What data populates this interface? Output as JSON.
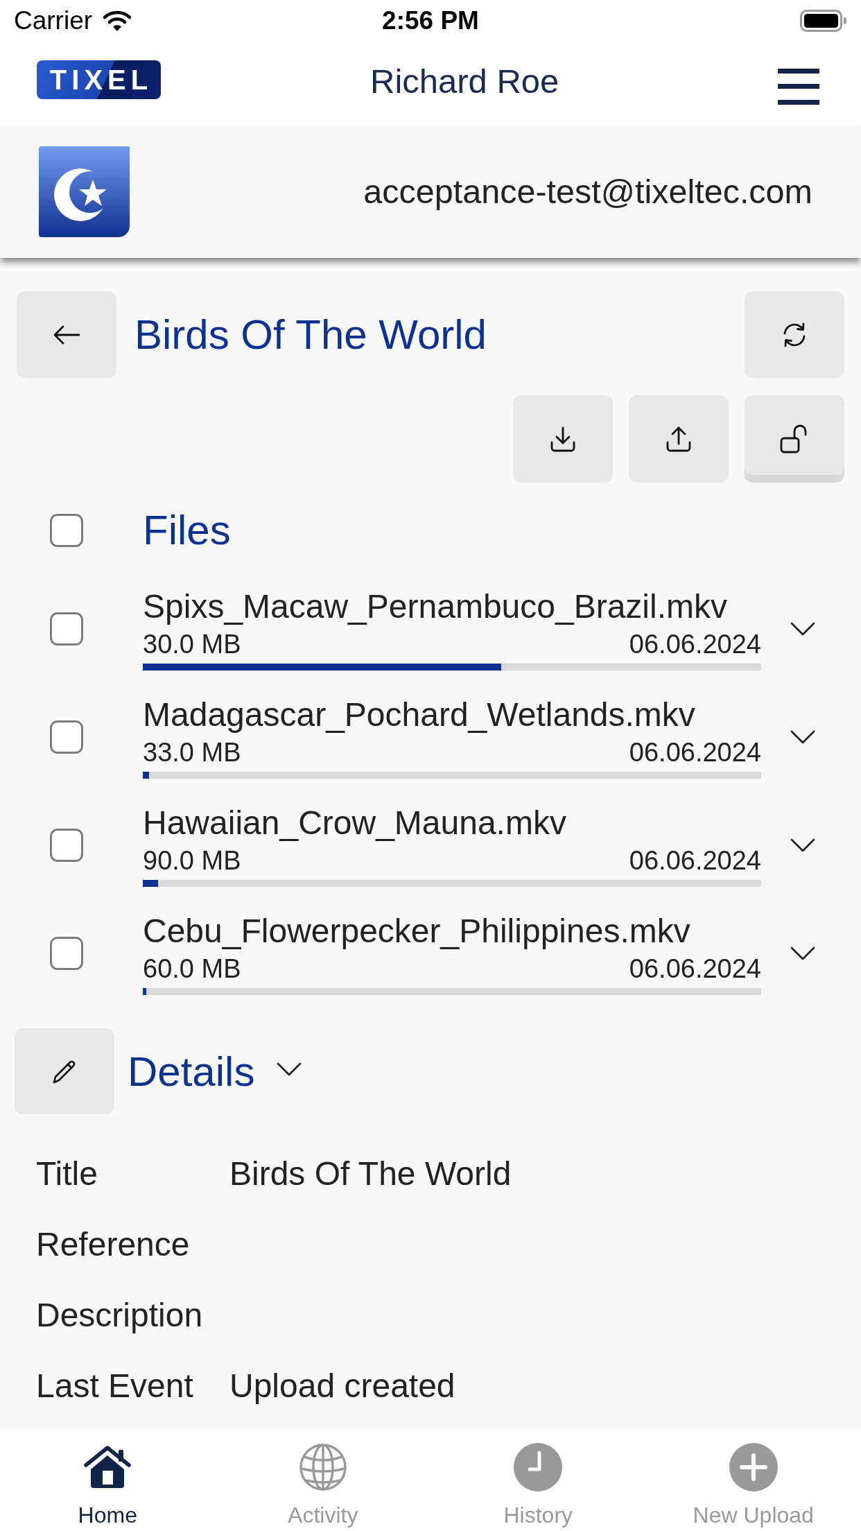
{
  "status_bar": {
    "carrier": "Carrier",
    "time": "2:56 PM"
  },
  "header": {
    "logo": "TIXEL",
    "user_name": "Richard Roe"
  },
  "account": {
    "email": "acceptance-test@tixeltec.com"
  },
  "folder": {
    "title": "Birds Of The World"
  },
  "files": {
    "heading": "Files",
    "select_all_checked": false,
    "items": [
      {
        "name": "Spixs_Macaw_Pernambuco_Brazil.mkv",
        "size": "30.0 MB",
        "date": "06.06.2024",
        "level": 0.58,
        "checked": false
      },
      {
        "name": "Madagascar_Pochard_Wetlands.mkv",
        "size": "33.0 MB",
        "date": "06.06.2024",
        "level": 0.01,
        "checked": false
      },
      {
        "name": "Hawaiian_Crow_Mauna.mkv",
        "size": "90.0 MB",
        "date": "06.06.2024",
        "level": 0.025,
        "checked": false
      },
      {
        "name": "Cebu_Flowerpecker_Philippines.mkv",
        "size": "60.0 MB",
        "date": "06.06.2024",
        "level": 0.006,
        "checked": false
      }
    ]
  },
  "details": {
    "heading": "Details",
    "fields": [
      {
        "label": "Title",
        "value": "Birds Of The World"
      },
      {
        "label": "Reference"
      },
      {
        "label": "Description"
      },
      {
        "label": "Last Event",
        "value": "Upload created"
      }
    ]
  },
  "tab_bar": [
    {
      "label": "Home",
      "selected": true
    },
    {
      "label": "Activity",
      "selected": false
    },
    {
      "label": "History",
      "selected": false
    },
    {
      "label": "New Upload",
      "selected": false
    }
  ]
}
